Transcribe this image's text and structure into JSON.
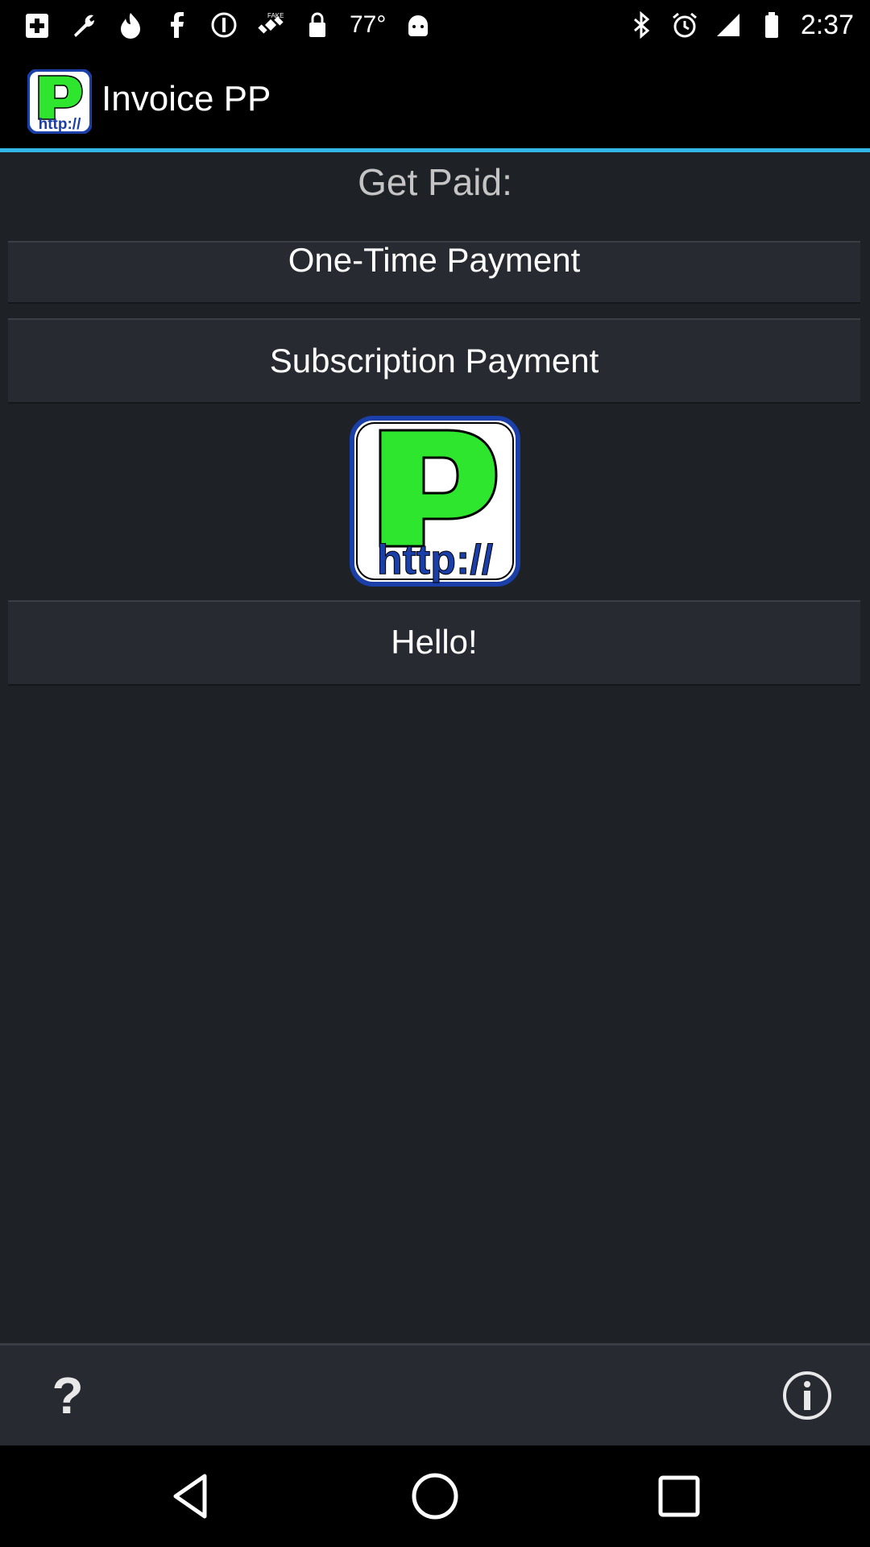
{
  "status_bar": {
    "temperature": "77°",
    "time": "2:37",
    "left_icons": [
      "plus-box-icon",
      "wrench-icon",
      "flame-icon",
      "facebook-icon",
      "minus-circle-icon",
      "fake-gps-satellite-icon",
      "lock-icon"
    ],
    "after_temp_icons": [
      "android-icon"
    ],
    "right_icons": [
      "bluetooth-icon",
      "alarm-icon",
      "signal-icon",
      "battery-icon"
    ]
  },
  "app_bar": {
    "title": "Invoice PP",
    "logo_letter": "P",
    "logo_subtext": "http://"
  },
  "main": {
    "heading": "Get Paid:",
    "buttons": {
      "one_time": "One-Time Payment",
      "subscription": "Subscription Payment",
      "hello": "Hello!"
    },
    "logo_letter": "P",
    "logo_subtext": "http://"
  },
  "toolbar": {
    "help_label": "?",
    "help_icon": "question-mark-icon",
    "info_icon": "info-icon"
  },
  "nav": {
    "back_icon": "back-triangle-icon",
    "home_icon": "home-circle-icon",
    "recent_icon": "recent-square-icon"
  },
  "colors": {
    "accent": "#33b5e5",
    "content_bg": "#1e2227",
    "button_bg": "#272b31",
    "logo_green": "#2ee62e",
    "logo_blue": "#1a3fa8"
  }
}
